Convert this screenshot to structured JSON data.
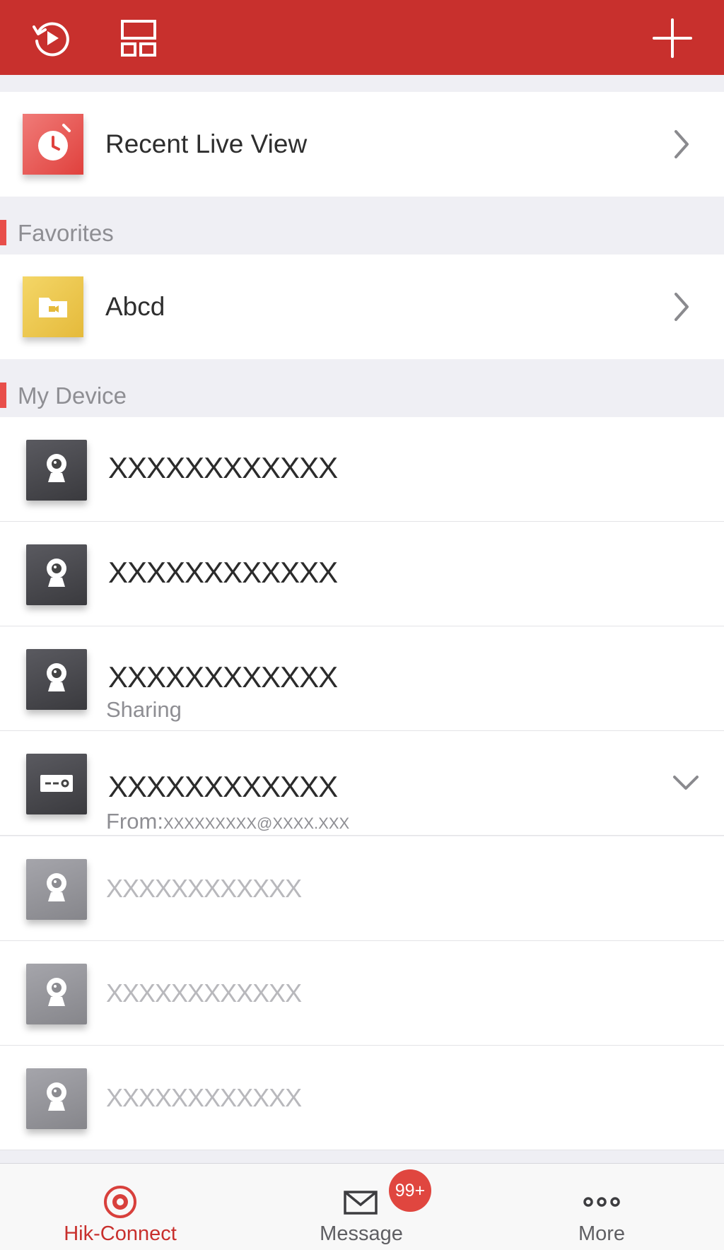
{
  "header": {
    "icons": [
      "replay-icon",
      "layout-icon",
      "add-icon"
    ],
    "background": "#c8302d"
  },
  "recent": {
    "label": "Recent Live View",
    "icon": "alarm-clock-icon"
  },
  "favorites": {
    "title": "Favorites",
    "items": [
      {
        "label": "Abcd",
        "icon": "folder-icon"
      }
    ]
  },
  "devices": {
    "title": "My Device",
    "items": [
      {
        "name": "XXXXXXXXXXXX",
        "type": "camera",
        "online": true
      },
      {
        "name": "XXXXXXXXXXXX",
        "type": "camera",
        "online": true
      },
      {
        "name": "XXXXXXXXXXXX",
        "type": "camera",
        "online": true,
        "sub": "Sharing"
      },
      {
        "name": "XXXXXXXXXXXX",
        "type": "dvr",
        "online": true,
        "sub_prefix": "From:",
        "sub_email": "XXXXXXXXX@XXXX.XXX",
        "expandable": true
      },
      {
        "name": "XXXXXXXXXXXX",
        "type": "camera",
        "online": false
      },
      {
        "name": "XXXXXXXXXXXX",
        "type": "camera",
        "online": false
      },
      {
        "name": "XXXXXXXXXXXX",
        "type": "camera",
        "online": false
      }
    ]
  },
  "tabs": [
    {
      "label": "Hik-Connect",
      "icon": "hik-connect-icon",
      "active": true
    },
    {
      "label": "Message",
      "icon": "envelope-icon",
      "badge": "99+"
    },
    {
      "label": "More",
      "icon": "more-dots-icon"
    }
  ]
}
